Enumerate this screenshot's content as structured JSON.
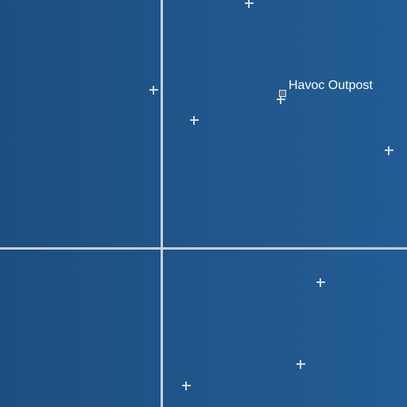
{
  "map": {
    "background_gradient": [
      "#1c4f7f",
      "#235c95"
    ],
    "grid_color": "#c8ced8",
    "marker_color": "#d4dbe6",
    "marker_icon": "crosshair-plus",
    "poi": {
      "name": "Havoc Outpost",
      "icon": "square-marker"
    }
  }
}
